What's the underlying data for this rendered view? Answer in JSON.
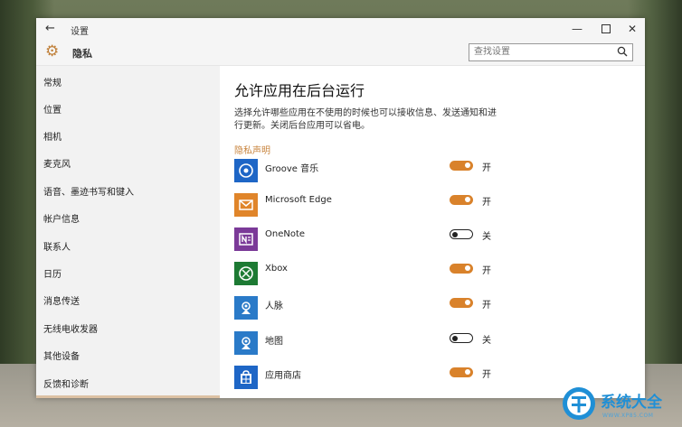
{
  "window": {
    "title": "设置",
    "back_glyph": "←",
    "min_glyph": "—",
    "close_glyph": "✕"
  },
  "header": {
    "title": "隐私",
    "search_placeholder": "查找设置"
  },
  "sidebar": {
    "items": [
      {
        "label": "常规"
      },
      {
        "label": "位置"
      },
      {
        "label": "相机"
      },
      {
        "label": "麦克风"
      },
      {
        "label": "语音、墨迹书写和键入"
      },
      {
        "label": "帐户信息"
      },
      {
        "label": "联系人"
      },
      {
        "label": "日历"
      },
      {
        "label": "消息传送"
      },
      {
        "label": "无线电收发器"
      },
      {
        "label": "其他设备"
      },
      {
        "label": "反馈和诊断"
      }
    ]
  },
  "main": {
    "title": "允许应用在后台运行",
    "description": "选择允许哪些应用在不使用的时候也可以接收信息、发送通知和进行更新。关闭后台应用可以省电。",
    "privacy_link": "隐私声明",
    "apps": [
      {
        "name": "Groove 音乐",
        "state": "开",
        "on": true,
        "tile_color": "#1e66c6",
        "icon": "music-icon"
      },
      {
        "name": "Microsoft Edge",
        "state": "开",
        "on": true,
        "tile_color": "#e0852a",
        "icon": "mail-icon"
      },
      {
        "name": "OneNote",
        "state": "关",
        "on": false,
        "tile_color": "#7b3a98",
        "icon": "onenote-icon"
      },
      {
        "name": "Xbox",
        "state": "开",
        "on": true,
        "tile_color": "#1d7a33",
        "icon": "xbox-icon"
      },
      {
        "name": "人脉",
        "state": "开",
        "on": true,
        "tile_color": "#2a7ac8",
        "icon": "people-icon"
      },
      {
        "name": "地图",
        "state": "关",
        "on": false,
        "tile_color": "#2a7ac8",
        "icon": "maps-icon"
      },
      {
        "name": "应用商店",
        "state": "开",
        "on": true,
        "tile_color": "#1e66c6",
        "icon": "store-icon"
      }
    ]
  },
  "colors": {
    "accent": "#d9822b",
    "link": "#c8843e"
  },
  "watermark": {
    "text": "系统大全",
    "sub": "WWW.XP85.COM"
  }
}
